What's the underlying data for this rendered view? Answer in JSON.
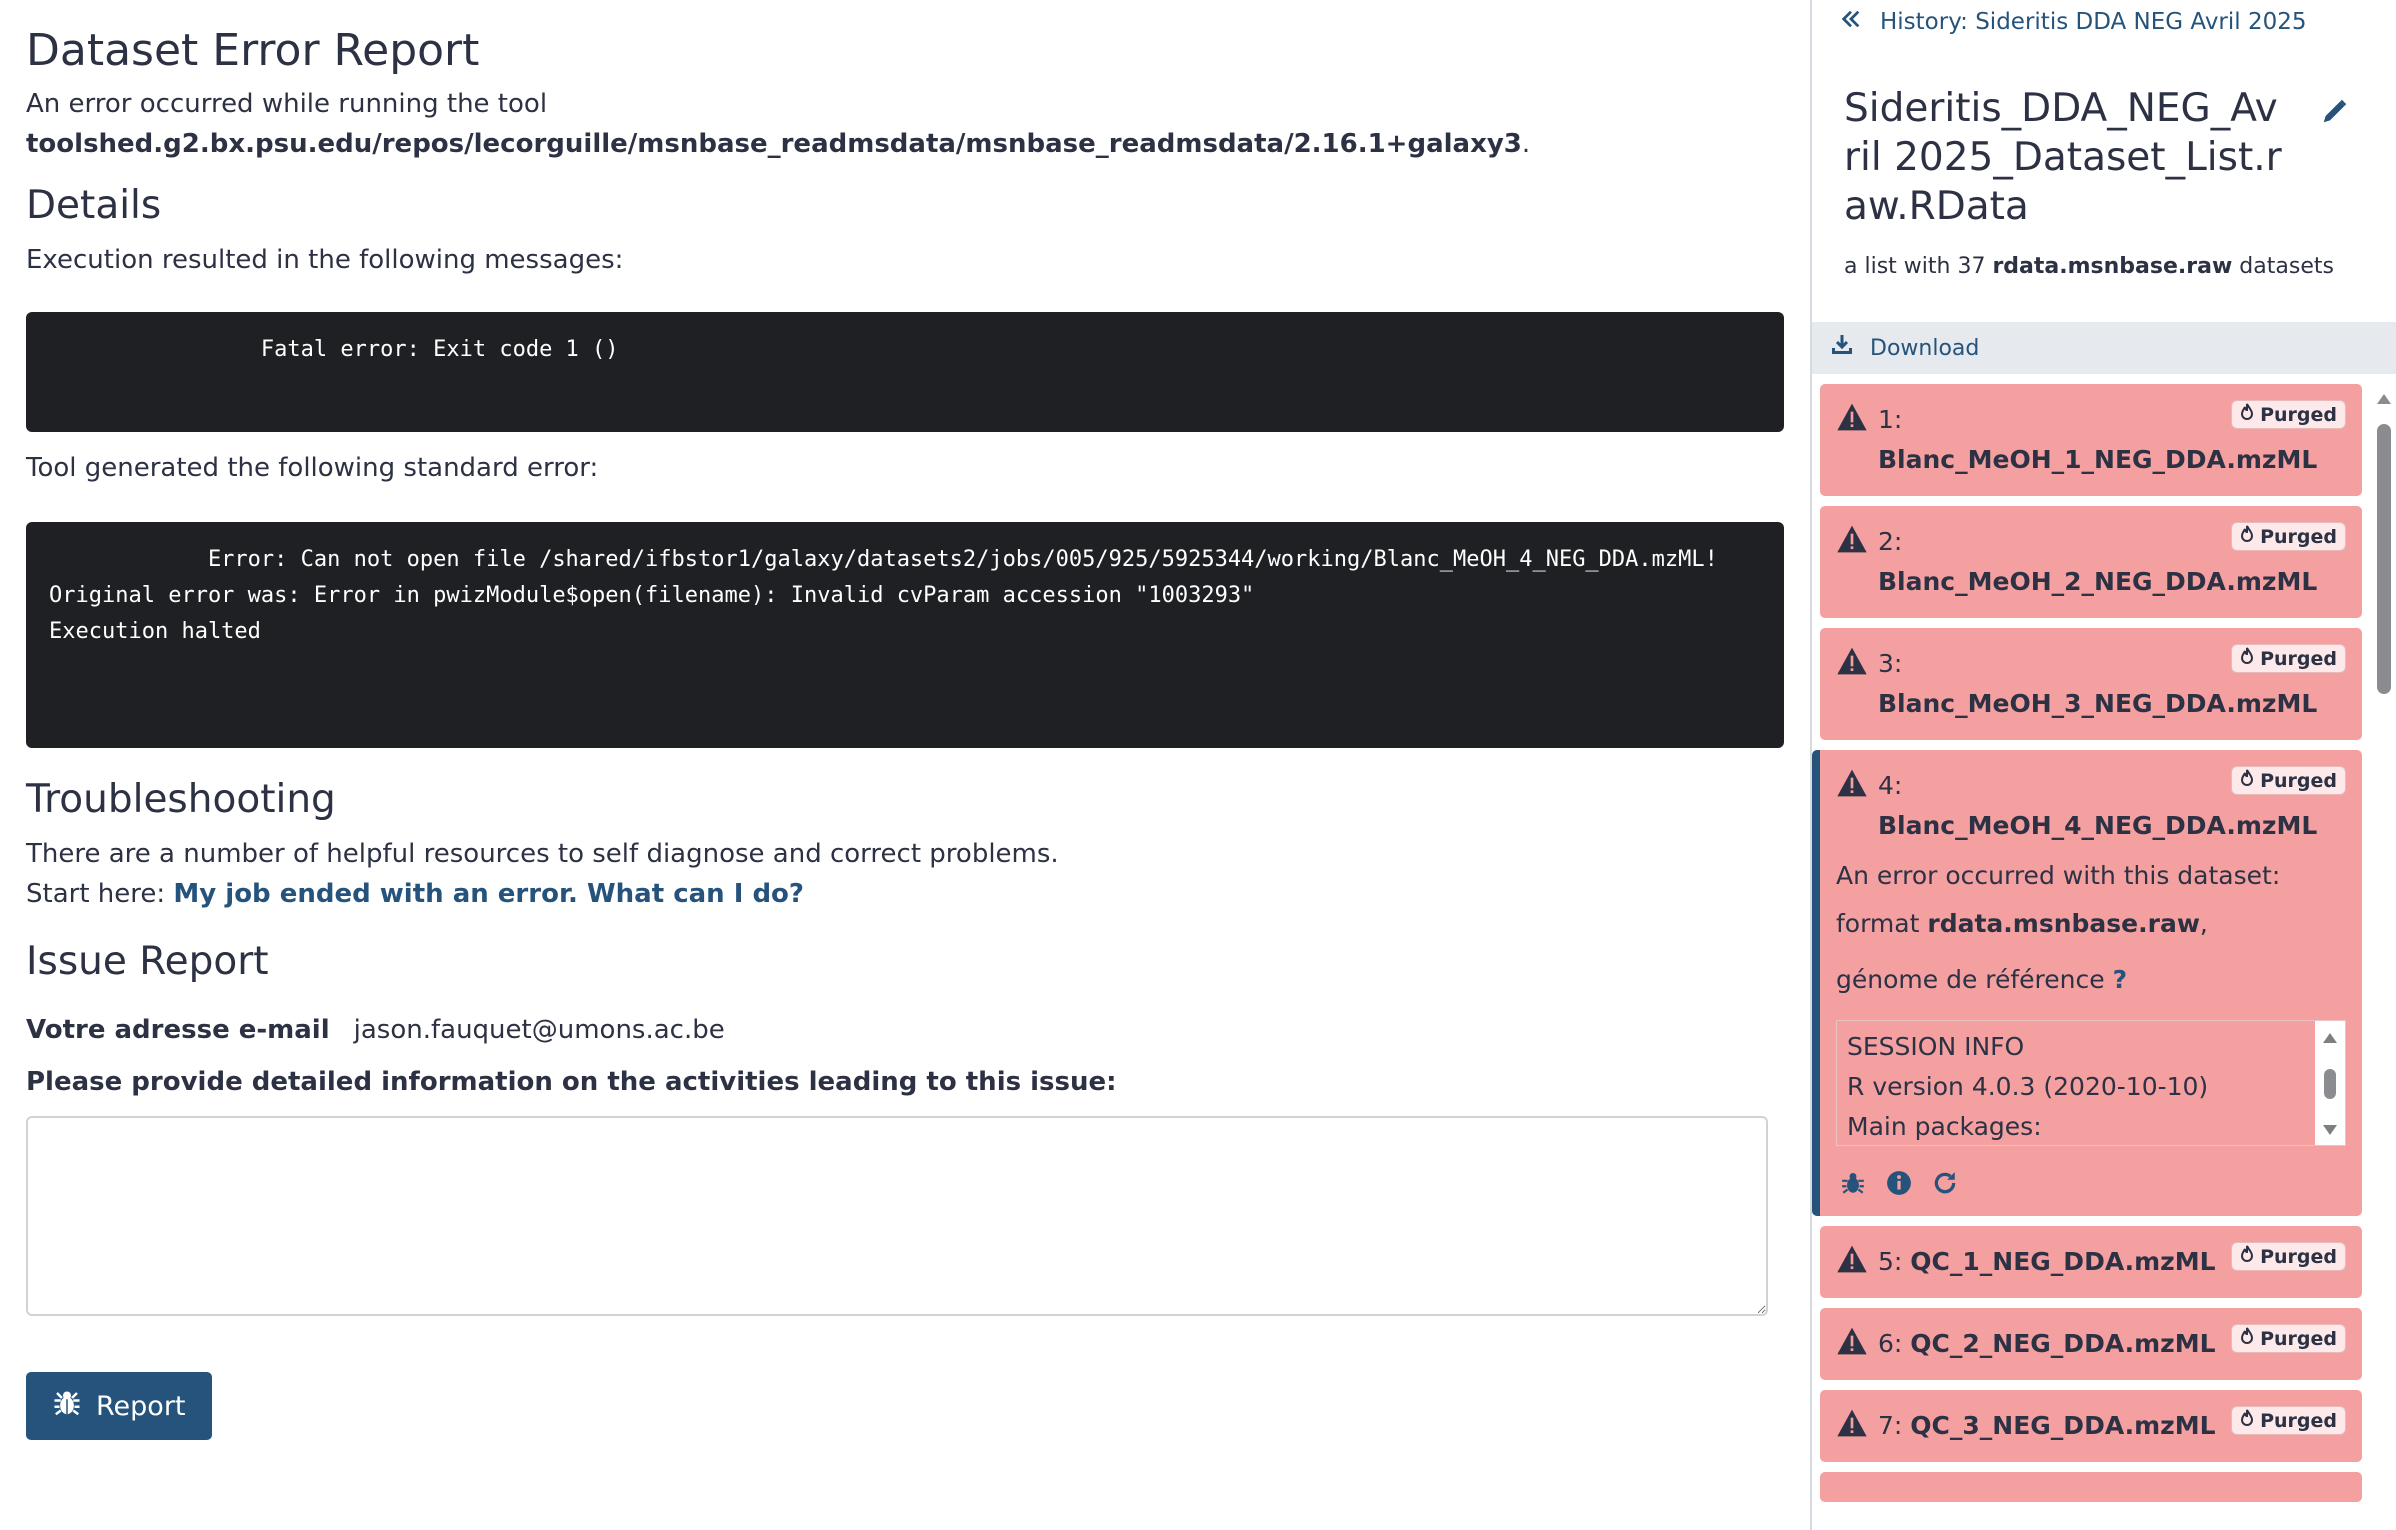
{
  "report": {
    "title": "Dataset Error Report",
    "intro": "An error occurred while running the tool",
    "tool_id": "toolshed.g2.bx.psu.edu/repos/lecorguille/msnbase_readmsdata/msnbase_readmsdata/2.16.1+galaxy3",
    "details_heading": "Details",
    "messages_label": "Execution resulted in the following messages:",
    "messages_code": "                Fatal error: Exit code 1 ()",
    "stderr_label": "Tool generated the following standard error:",
    "stderr_code": "            Error: Can not open file /shared/ifbstor1/galaxy/datasets2/jobs/005/925/5925344/working/Blanc_MeOH_4_NEG_DDA.mzML!\nOriginal error was: Error in pwizModule$open(filename): Invalid cvParam accession \"1003293\"\nExecution halted",
    "troubleshooting_heading": "Troubleshooting",
    "troubleshooting_text": "There are a number of helpful resources to self diagnose and correct problems.",
    "start_here": "Start here:",
    "help_link": "My job ended with an error. What can I do?",
    "issue_heading": "Issue Report",
    "email_label": "Votre adresse e-mail",
    "email_value": "jason.fauquet@umons.ac.be",
    "details_prompt": "Please provide detailed information on the activities leading to this issue:",
    "report_button": "Report"
  },
  "panel": {
    "history_link": "History: Sideritis DDA NEG Avril 2025",
    "collection_title": "Sideritis_DDA_NEG_Avril 2025_Dataset_List.raw.RData",
    "summary_prefix": "a list with 37",
    "summary_format": "rdata.msnbase.raw",
    "summary_suffix": "datasets",
    "download": "Download",
    "items": [
      {
        "num": "1:",
        "name": "Blanc_MeOH_1_NEG_DDA.mzML",
        "badge": "Purged"
      },
      {
        "num": "2:",
        "name": "Blanc_MeOH_2_NEG_DDA.mzML",
        "badge": "Purged"
      },
      {
        "num": "3:",
        "name": "Blanc_MeOH_3_NEG_DDA.mzML",
        "badge": "Purged"
      },
      {
        "num": "4:",
        "name": "Blanc_MeOH_4_NEG_DDA.mzML",
        "badge": "Purged"
      },
      {
        "num": "5:",
        "name": "QC_1_NEG_DDA.mzML",
        "badge": "Purged"
      },
      {
        "num": "6:",
        "name": "QC_2_NEG_DDA.mzML",
        "badge": "Purged"
      },
      {
        "num": "7:",
        "name": "QC_3_NEG_DDA.mzML",
        "badge": "Purged"
      }
    ],
    "expanded": {
      "error_text": "An error occurred with this dataset:",
      "format_label": "format",
      "format_value": "rdata.msnbase.raw",
      "genome_label": "génome de référence",
      "genome_q": "?",
      "session_lines": [
        "SESSION INFO",
        "R version 4.0.3 (2020-10-10)",
        "Main packages:"
      ]
    }
  },
  "colors": {
    "primary": "#25537b",
    "error_bg": "#f4a0a1",
    "code_bg": "#1e2023"
  }
}
